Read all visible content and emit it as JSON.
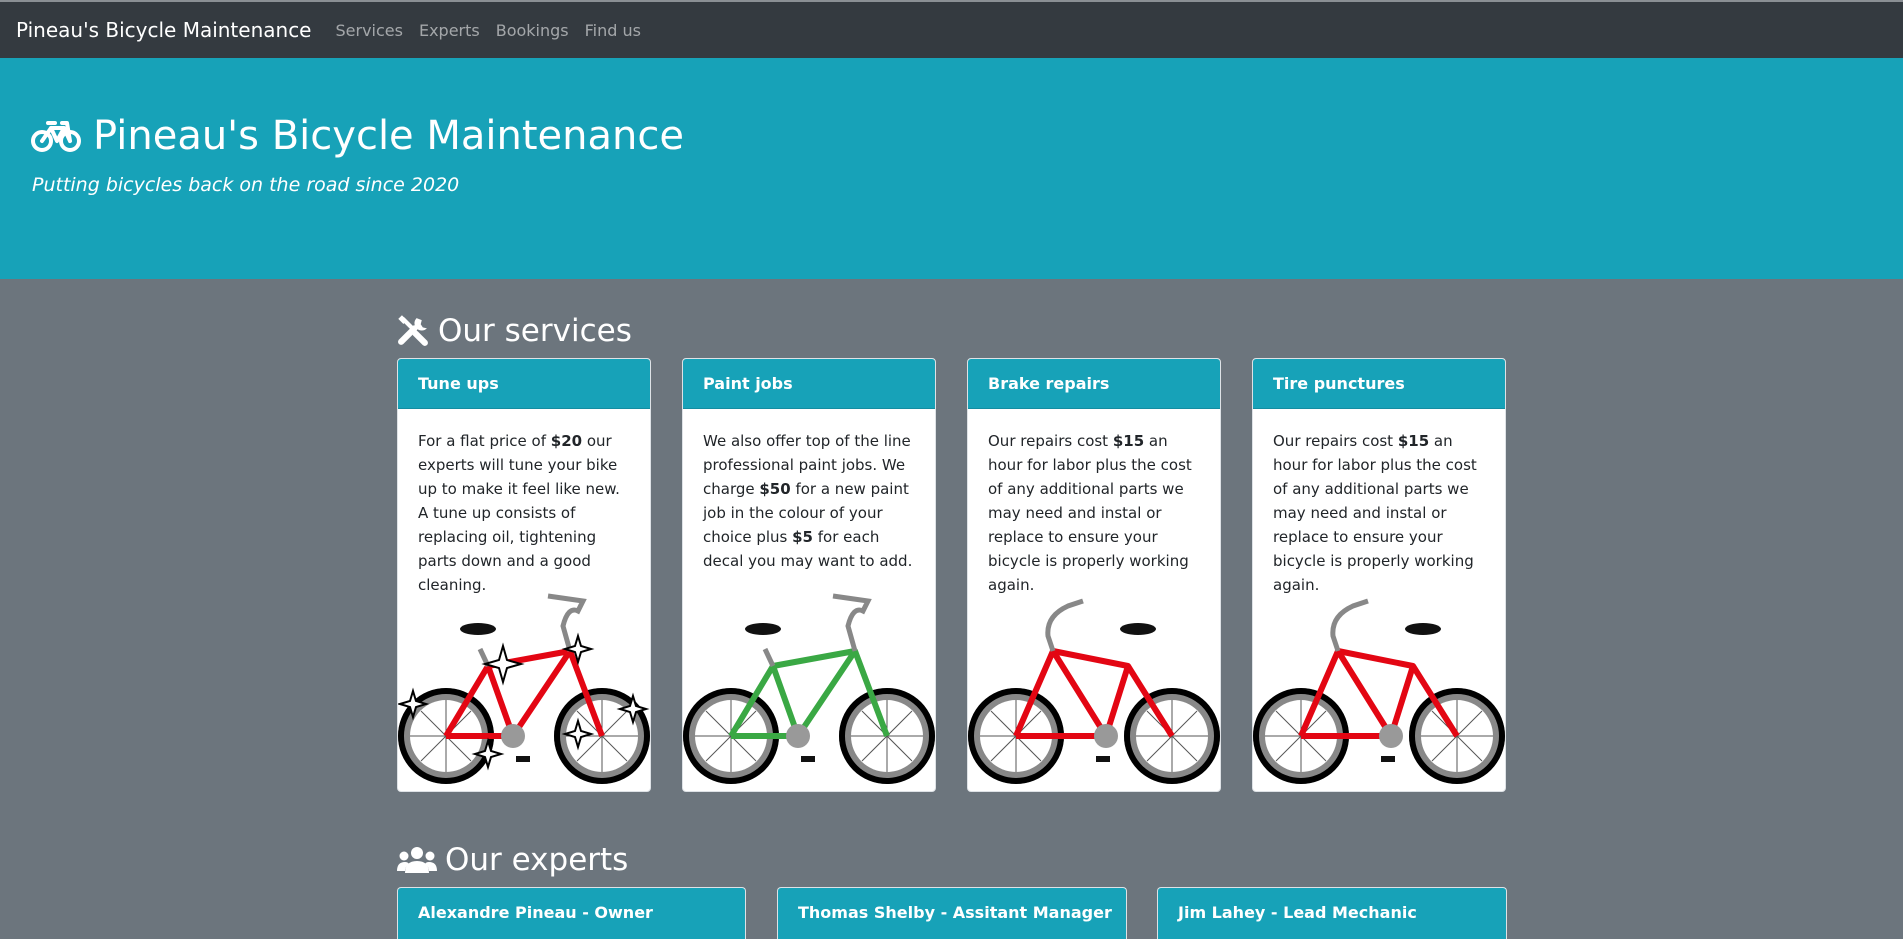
{
  "navbar": {
    "brand": "Pineau's Bicycle Maintenance",
    "links": [
      "Services",
      "Experts",
      "Bookings",
      "Find us"
    ]
  },
  "jumbotron": {
    "icon": "bicycle-icon",
    "title": "Pineau's Bicycle Maintenance",
    "subtitle": "Putting bicycles back on the road since 2020"
  },
  "services": {
    "icon": "tools-icon",
    "heading": "Our services",
    "cards": [
      {
        "title": "Tune ups",
        "pre": "For a flat price of ",
        "bold": "$20",
        "post": " our experts will tune your bike up to make it feel like new. A tune up consists of replacing oil, tightening parts down and a good cleaning.",
        "image": "shiny-red-bicycle"
      },
      {
        "title": "Paint jobs",
        "pre": "We also offer top of the line professional paint jobs. We charge ",
        "bold": "$50",
        "mid": " for a new paint job in the colour of your choice plus ",
        "bold2": "$5",
        "post": " for each decal you may want to add.",
        "image": "green-bicycle"
      },
      {
        "title": "Brake repairs",
        "pre": "Our repairs cost ",
        "bold": "$15",
        "post": " an hour for labor plus the cost of any additional parts we may need and instal or replace to ensure your bicycle is properly working again.",
        "image": "red-bicycle"
      },
      {
        "title": "Tire punctures",
        "pre": "Our repairs cost ",
        "bold": "$15",
        "post": " an hour for labor plus the cost of any additional parts we may need and instal or replace to ensure your bicycle is properly working again.",
        "image": "red-bicycle"
      }
    ]
  },
  "experts": {
    "icon": "users-icon",
    "heading": "Our experts",
    "names": [
      "Alexandre Pineau - Owner",
      "Thomas Shelby - Assitant Manager",
      "Jim Lahey - Lead Mechanic"
    ]
  },
  "colors": {
    "navbar": "#343a40",
    "jumbotron": "#17a2b8",
    "page_background": "#6c757d",
    "card_header": "#17a2b8",
    "bike_red": "#e30613",
    "bike_green": "#3aa844"
  }
}
